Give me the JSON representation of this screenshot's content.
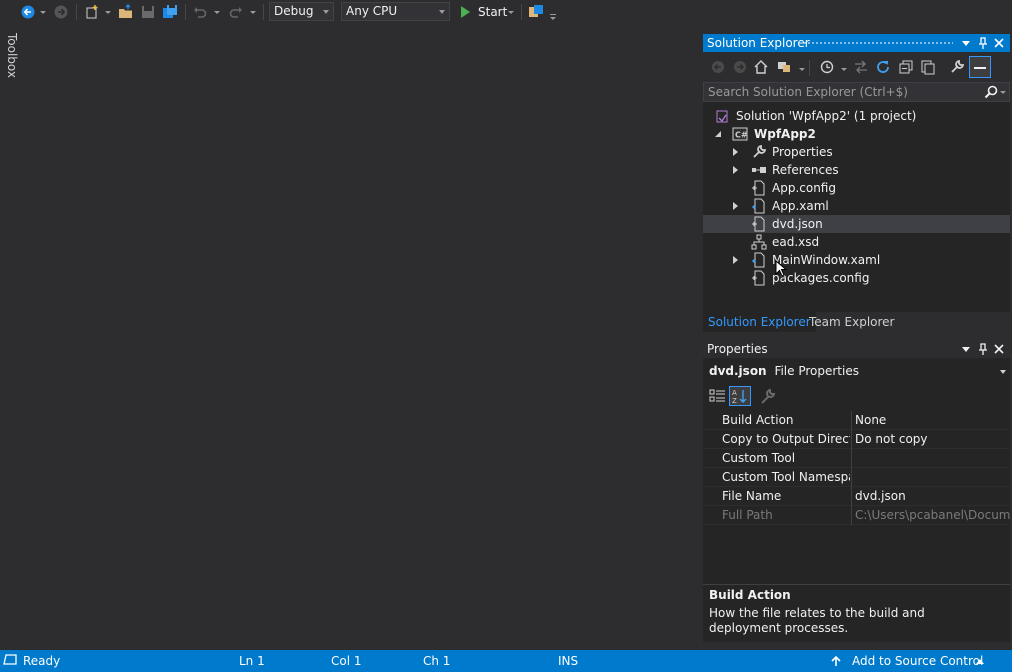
{
  "toolbar": {
    "config": "Debug",
    "platform": "Any CPU",
    "start_label": "Start",
    "icons": [
      "back-icon",
      "forward-icon",
      "new-project-icon",
      "open-file-icon",
      "save-icon",
      "save-all-icon",
      "undo-icon",
      "redo-icon",
      "start-icon",
      "find-in-files-icon"
    ]
  },
  "toolbox": {
    "label": "Toolbox"
  },
  "solution_explorer": {
    "title": "Solution Explorer",
    "search_placeholder": "Search Solution Explorer (Ctrl+$)",
    "solution": "Solution 'WpfApp2' (1 project)",
    "project": "WpfApp2",
    "items": [
      {
        "label": "Properties",
        "icon": "wrench-icon",
        "expandable": true
      },
      {
        "label": "References",
        "icon": "references-icon",
        "expandable": true
      },
      {
        "label": "App.config",
        "icon": "config-file-icon",
        "expandable": false
      },
      {
        "label": "App.xaml",
        "icon": "xaml-file-icon",
        "expandable": true
      },
      {
        "label": "dvd.json",
        "icon": "json-file-icon",
        "expandable": false,
        "selected": true
      },
      {
        "label": "ead.xsd",
        "icon": "xsd-file-icon",
        "expandable": false
      },
      {
        "label": "MainWindow.xaml",
        "icon": "xaml-file-icon",
        "expandable": true
      },
      {
        "label": "packages.config",
        "icon": "config-file-icon",
        "expandable": false
      }
    ],
    "tabs": [
      "Solution Explorer",
      "Team Explorer"
    ]
  },
  "properties": {
    "title": "Properties",
    "object_name": "dvd.json",
    "object_type": "File Properties",
    "rows": [
      {
        "name": "Build Action",
        "value": "None"
      },
      {
        "name": "Copy to Output Directory",
        "value": "Do not copy"
      },
      {
        "name": "Custom Tool",
        "value": ""
      },
      {
        "name": "Custom Tool Namespace",
        "value": ""
      },
      {
        "name": "File Name",
        "value": "dvd.json"
      },
      {
        "name": "Full Path",
        "value": "C:\\Users\\pcabanel\\Documents",
        "disabled": true
      }
    ],
    "desc_title": "Build Action",
    "desc_text": "How the file relates to the build and deployment processes."
  },
  "statusbar": {
    "status": "Ready",
    "ln": "Ln 1",
    "col": "Col 1",
    "ch": "Ch 1",
    "ins": "INS",
    "source_control": "Add to Source Control"
  },
  "colors": {
    "accent": "#007acc",
    "background": "#2d2d30",
    "panel": "#252526"
  }
}
